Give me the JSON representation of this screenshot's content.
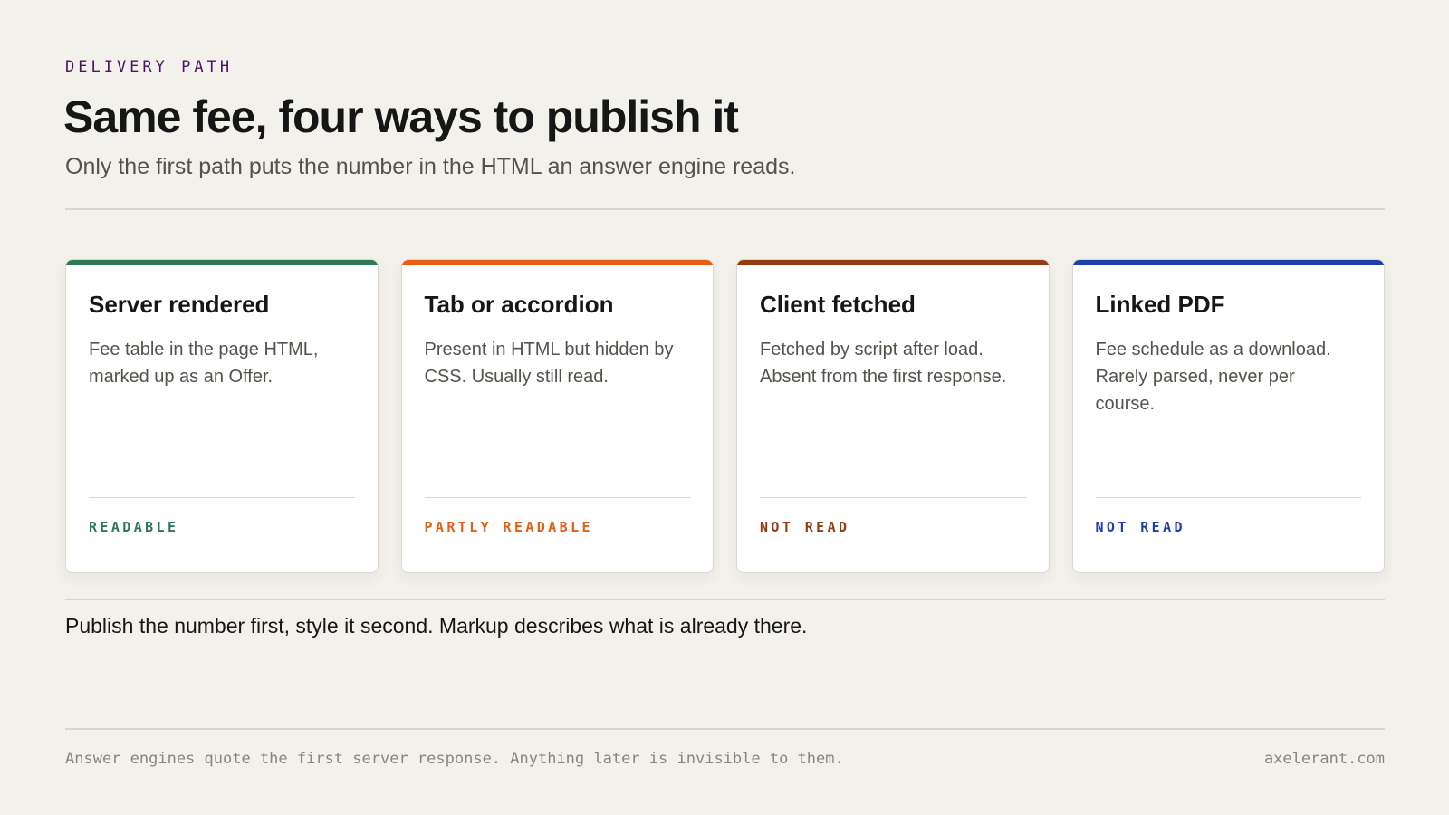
{
  "header": {
    "eyebrow": "DELIVERY PATH",
    "title": "Same fee, four ways to publish it",
    "subtitle": "Only the first path puts the number in the HTML an answer engine reads."
  },
  "cards": [
    {
      "title": "Server rendered",
      "description": "Fee table in the page HTML, marked up as an Offer.",
      "status": "READABLE",
      "accent_color": "#2e7a56"
    },
    {
      "title": "Tab or accordion",
      "description": "Present in HTML but hidden by CSS. Usually still read.",
      "status": "PARTLY READABLE",
      "accent_color": "#e85d14"
    },
    {
      "title": "Client fetched",
      "description": "Fetched by script after load. Absent from the first response.",
      "status": "NOT READ",
      "accent_color": "#953b10"
    },
    {
      "title": "Linked PDF",
      "description": "Fee schedule as a download. Rarely parsed, never per course.",
      "status": "NOT READ",
      "accent_color": "#1f3fa8"
    }
  ],
  "takeaway": "Publish the number first, style it second. Markup describes what is already there.",
  "footer": {
    "note": "Answer engines quote the first server response. Anything later is invisible to them.",
    "site": "axelerant.com"
  },
  "colors": {
    "background": "#f3f1eb",
    "eyebrow": "#4a1560",
    "text": "#161616",
    "muted": "#55524c"
  }
}
